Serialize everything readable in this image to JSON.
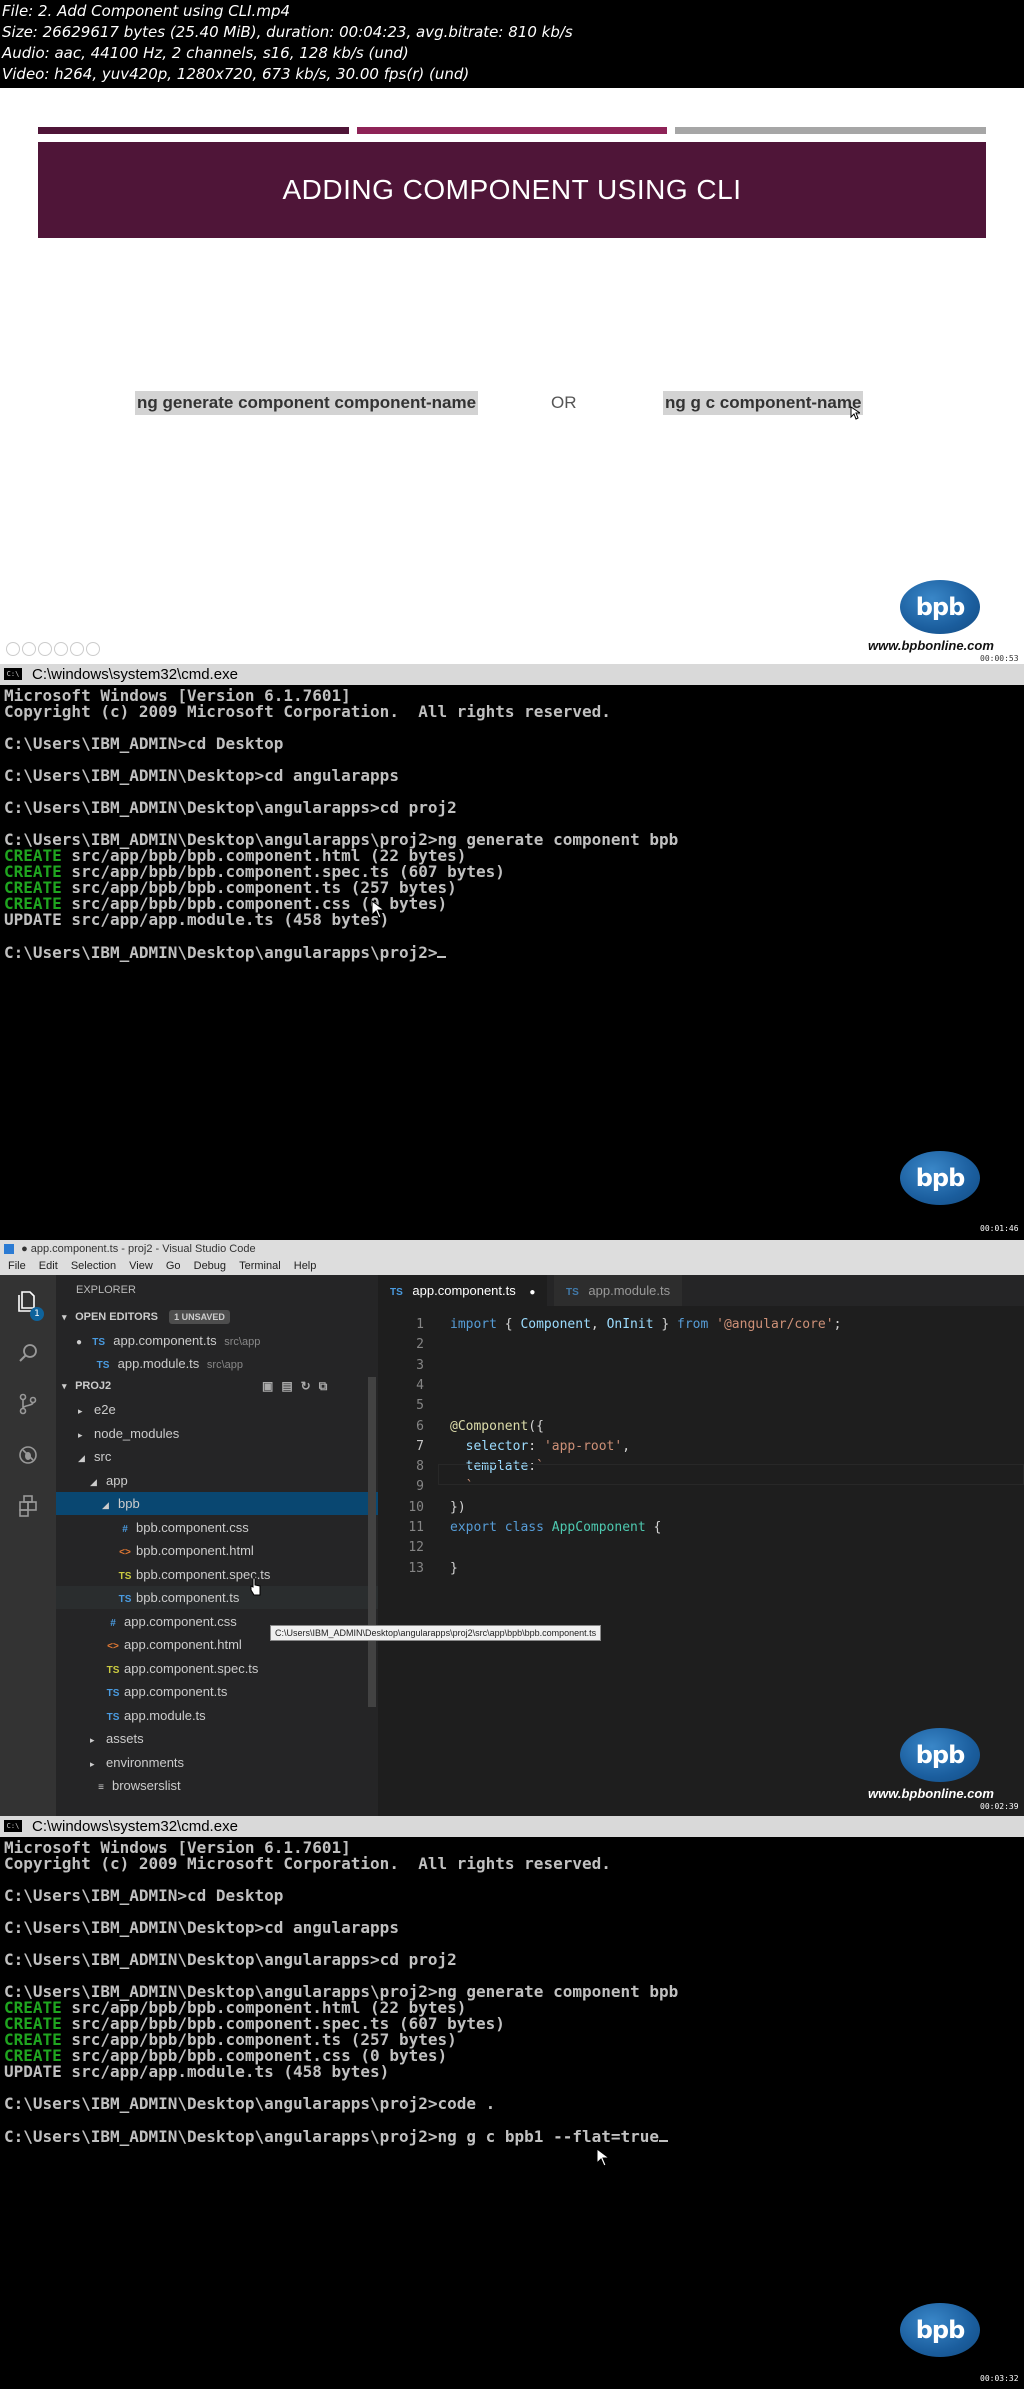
{
  "header": {
    "lines": [
      "File: 2. Add Component using CLI.mp4",
      "Size: 26629617 bytes (25.40 MiB), duration: 00:04:23, avg.bitrate: 810 kb/s",
      "Audio: aac, 44100 Hz, 2 channels, s16, 128 kb/s (und)",
      "Video: h264, yuv420p, 1280x720, 673 kb/s, 30.00 fps(r) (und)"
    ]
  },
  "slide": {
    "title": "ADDING COMPONENT USING CLI",
    "command_long": "ng generate component component-name",
    "or_text": "OR",
    "command_short": "ng g c component-name",
    "logo_text": "bpb",
    "website": "www.bpbonline.com",
    "timestamp": "00:00:53",
    "colors": {
      "banner": "#4f1538",
      "bar1": "#4f1538",
      "bar2": "#8e2357",
      "bar3": "#a6a6a6"
    }
  },
  "cmd1": {
    "title": "C:\\windows\\system32\\cmd.exe",
    "lines": [
      {
        "t": "Microsoft Windows [Version 6.1.7601]"
      },
      {
        "t": "Copyright (c) 2009 Microsoft Corporation.  All rights reserved."
      },
      {
        "t": ""
      },
      {
        "t": "C:\\Users\\IBM_ADMIN>cd Desktop"
      },
      {
        "t": ""
      },
      {
        "t": "C:\\Users\\IBM_ADMIN\\Desktop>cd angularapps"
      },
      {
        "t": ""
      },
      {
        "t": "C:\\Users\\IBM_ADMIN\\Desktop\\angularapps>cd proj2"
      },
      {
        "t": ""
      },
      {
        "t": "C:\\Users\\IBM_ADMIN\\Desktop\\angularapps\\proj2>ng generate component bpb"
      },
      {
        "kw": "CREATE",
        "t": " src/app/bpb/bpb.component.html (22 bytes)"
      },
      {
        "kw": "CREATE",
        "t": " src/app/bpb/bpb.component.spec.ts (607 bytes)"
      },
      {
        "kw": "CREATE",
        "t": " src/app/bpb/bpb.component.ts (257 bytes)"
      },
      {
        "kw": "CREATE",
        "t": " src/app/bpb/bpb.component.css (0 bytes)"
      },
      {
        "t": "UPDATE src/app/app.module.ts (458 bytes)"
      },
      {
        "t": ""
      },
      {
        "t": "C:\\Users\\IBM_ADMIN\\Desktop\\angularapps\\proj2>",
        "cursor": true
      }
    ],
    "logo_text": "bpb",
    "timestamp": "00:01:46"
  },
  "vscode": {
    "window_title": "● app.component.ts - proj2 - Visual Studio Code",
    "menu": [
      "File",
      "Edit",
      "Selection",
      "View",
      "Go",
      "Debug",
      "Terminal",
      "Help"
    ],
    "explorer_label": "EXPLORER",
    "open_editors_label": "OPEN EDITORS",
    "unsaved_badge": "1 UNSAVED",
    "badge_count": "1",
    "open_editors": [
      {
        "name": "app.component.ts",
        "path": "src\\app",
        "icon": "TS",
        "dirty": true
      },
      {
        "name": "app.module.ts",
        "path": "src\\app",
        "icon": "TS",
        "dirty": false
      }
    ],
    "project_label": "PROJ2",
    "tree": [
      {
        "name": "e2e",
        "kind": "folder-closed",
        "depth": 1
      },
      {
        "name": "node_modules",
        "kind": "folder-closed",
        "depth": 1
      },
      {
        "name": "src",
        "kind": "folder-open",
        "depth": 1
      },
      {
        "name": "app",
        "kind": "folder-open",
        "depth": 2
      },
      {
        "name": "bpb",
        "kind": "folder-open",
        "depth": 3,
        "selected": true
      },
      {
        "name": "bpb.component.css",
        "kind": "css",
        "icon": "#",
        "depth": 4
      },
      {
        "name": "bpb.component.html",
        "kind": "html",
        "icon": "<>",
        "depth": 4
      },
      {
        "name": "bpb.component.spec.ts",
        "kind": "spec",
        "icon": "TS",
        "depth": 4
      },
      {
        "name": "bpb.component.ts",
        "kind": "ts",
        "icon": "TS",
        "depth": 4,
        "hover": true
      },
      {
        "name": "app.component.css",
        "kind": "css",
        "icon": "#",
        "depth": 3
      },
      {
        "name": "app.component.html",
        "kind": "html",
        "icon": "<>",
        "depth": 3
      },
      {
        "name": "app.component.spec.ts",
        "kind": "spec",
        "icon": "TS",
        "depth": 3
      },
      {
        "name": "app.component.ts",
        "kind": "ts",
        "icon": "TS",
        "depth": 3
      },
      {
        "name": "app.module.ts",
        "kind": "ts",
        "icon": "TS",
        "depth": 3
      },
      {
        "name": "assets",
        "kind": "folder-closed",
        "depth": 2
      },
      {
        "name": "environments",
        "kind": "folder-closed",
        "depth": 2
      },
      {
        "name": "browserslist",
        "kind": "file",
        "icon": "≡",
        "depth": 2
      }
    ],
    "tooltip": "C:\\Users\\IBM_ADMIN\\Desktop\\angularapps\\proj2\\src\\app\\bpb\\bpb.component.ts",
    "tabs": [
      {
        "name": "app.component.ts",
        "icon": "TS",
        "active": true,
        "dirty": true
      },
      {
        "name": "app.module.ts",
        "icon": "TS",
        "active": false,
        "dirty": false
      }
    ],
    "code": [
      {
        "n": "1",
        "html": "<span class='kw'>import</span><span class='pl'> { </span><span class='prop'>Component</span><span class='pl'>, </span><span class='prop'>OnInit</span><span class='pl'> } </span><span class='kw'>from</span><span class='pl'> </span><span class='str'>'@angular/core'</span><span class='pl'>;</span>"
      },
      {
        "n": "2",
        "html": ""
      },
      {
        "n": "3",
        "html": ""
      },
      {
        "n": "4",
        "html": ""
      },
      {
        "n": "5",
        "html": ""
      },
      {
        "n": "6",
        "html": "<span class='dec'>@Component</span><span class='pl'>({</span>"
      },
      {
        "n": "7",
        "html": "<span class='pl'>  </span><span class='prop'>selector</span><span class='pl'>: </span><span class='str'>'app-root'</span><span class='pl'>,</span>"
      },
      {
        "n": "8",
        "html": "<span class='pl'>  </span><span class='prop'>template</span><span class='pl'>:</span><span class='str'>`</span>"
      },
      {
        "n": "9",
        "html": "<span class='str'>  `</span>"
      },
      {
        "n": "10",
        "html": "<span class='pl'>})</span>"
      },
      {
        "n": "11",
        "html": "<span class='kw'>export</span><span class='pl'> </span><span class='kw'>class</span><span class='pl'> </span><span class='cls'>AppComponent</span><span class='pl'> {</span>"
      },
      {
        "n": "12",
        "html": ""
      },
      {
        "n": "13",
        "html": "<span class='pl'>}</span>"
      }
    ],
    "logo_text": "bpb",
    "website": "www.bpbonline.com",
    "timestamp": "00:02:39"
  },
  "cmd2": {
    "title": "C:\\windows\\system32\\cmd.exe",
    "lines": [
      {
        "t": "Microsoft Windows [Version 6.1.7601]"
      },
      {
        "t": "Copyright (c) 2009 Microsoft Corporation.  All rights reserved."
      },
      {
        "t": ""
      },
      {
        "t": "C:\\Users\\IBM_ADMIN>cd Desktop"
      },
      {
        "t": ""
      },
      {
        "t": "C:\\Users\\IBM_ADMIN\\Desktop>cd angularapps"
      },
      {
        "t": ""
      },
      {
        "t": "C:\\Users\\IBM_ADMIN\\Desktop\\angularapps>cd proj2"
      },
      {
        "t": ""
      },
      {
        "t": "C:\\Users\\IBM_ADMIN\\Desktop\\angularapps\\proj2>ng generate component bpb"
      },
      {
        "kw": "CREATE",
        "t": " src/app/bpb/bpb.component.html (22 bytes)"
      },
      {
        "kw": "CREATE",
        "t": " src/app/bpb/bpb.component.spec.ts (607 bytes)"
      },
      {
        "kw": "CREATE",
        "t": " src/app/bpb/bpb.component.ts (257 bytes)"
      },
      {
        "kw": "CREATE",
        "t": " src/app/bpb/bpb.component.css (0 bytes)"
      },
      {
        "t": "UPDATE src/app/app.module.ts (458 bytes)"
      },
      {
        "t": ""
      },
      {
        "t": "C:\\Users\\IBM_ADMIN\\Desktop\\angularapps\\proj2>code ."
      },
      {
        "t": ""
      },
      {
        "t": "C:\\Users\\IBM_ADMIN\\Desktop\\angularapps\\proj2>ng g c bpb1 --flat=true",
        "cursor": true
      }
    ],
    "logo_text": "bpb",
    "timestamp": "00:03:32"
  }
}
